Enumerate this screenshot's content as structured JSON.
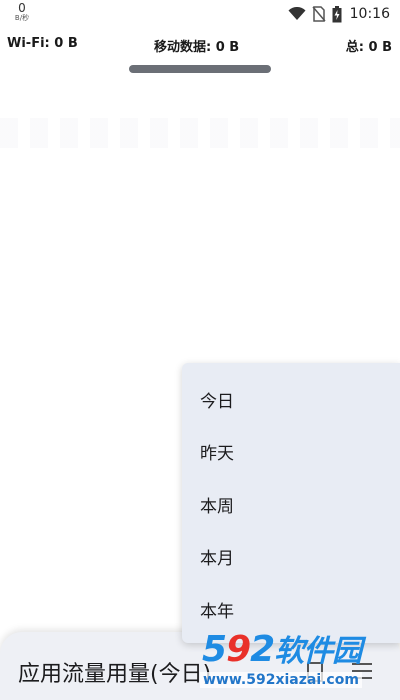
{
  "status_bar": {
    "speed_value": "0",
    "speed_unit": "B/秒",
    "time": "10:16",
    "icons": [
      "wifi-icon",
      "no-sim-icon",
      "battery-charging-icon"
    ]
  },
  "usage": {
    "wifi": "Wi-Fi: 0 B",
    "mobile": "移动数据: 0 B",
    "total": "总: 0 B"
  },
  "bottom_sheet": {
    "title": "应用流量用量(今日)",
    "icons": [
      "calendar-icon",
      "menu-icon"
    ]
  },
  "period_menu": {
    "items": [
      "今日",
      "昨天",
      "本周",
      "本月",
      "本年"
    ]
  },
  "watermark": {
    "logo_digits": [
      "5",
      "9",
      "2"
    ],
    "logo_text": "软件园",
    "url": "www.592xiazai.com"
  }
}
